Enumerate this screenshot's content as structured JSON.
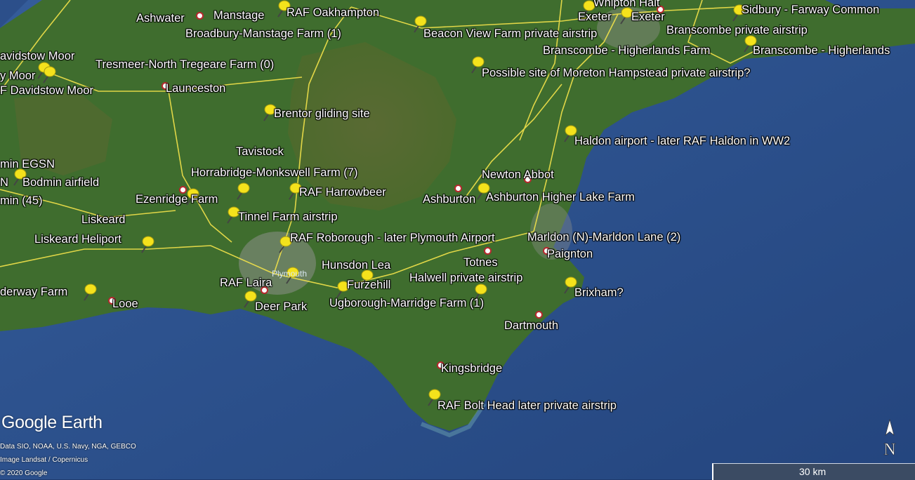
{
  "map": {
    "attribution": {
      "logo": "Google Earth",
      "lines": [
        "Data SIO, NOAA, U.S. Navy, NGA, GEBCO",
        "Image Landsat / Copernicus",
        "© 2020 Google"
      ]
    },
    "scale": "30 km",
    "compass": "N",
    "colors": {
      "sea": "#2a4e8c",
      "land": "#3f6d2e",
      "roads": "#f2e24a",
      "pin": "#f4e21c",
      "town_dot": "#b8282e"
    },
    "pins": [
      "RAF Oakhampton",
      "Broadbury-Manstage Farm (1)",
      "Beacon View Farm private airstrip",
      "Sidbury - Farway Common",
      "Branscombe private airstrip",
      "Branscombe - Higherlands Farm",
      "Branscombe - Higherlands",
      "Possible site of Moreton Hampstead private airstrip?",
      "avidstow Moor",
      "y Moor",
      "F Davidstow Moor",
      "Tresmeer-North Tregeare Farm (0)",
      "Brentor gliding site",
      "Haldon airport - later RAF Haldon in WW2",
      "min EGSN",
      "N",
      "Bodmin airfield",
      "min (45)",
      "Horrabridge-Monkswell Farm (7)",
      "RAF Harrowbeer",
      "Ezenridge Farm",
      "Tinnel Farm airstrip",
      "Ashburton Higher Lake Farm",
      "Liskeard Heliport",
      "RAF Roborough - later Plymouth Airport",
      "Marldon (N)-Marldon Lane (2)",
      "Hunsdon Lea",
      "RAF Laira",
      "Furzehill",
      "Halwell private airstrip",
      "Brixham?",
      "derway Farm",
      "Deer Park",
      "Ugborough-Marridge Farm (1)",
      "RAF Bolt Head later private airstrip",
      "Whipton Halt"
    ],
    "towns": [
      "Ashwater",
      "Manstage",
      "Exeter",
      "Exeter",
      "Launceston",
      "Tavistock",
      "Newton Abbot",
      "Ashburton",
      "Liskeard",
      "Paignton",
      "Totnes",
      "Plymouth",
      "Looe",
      "Dartmouth",
      "Kingsbridge"
    ]
  }
}
